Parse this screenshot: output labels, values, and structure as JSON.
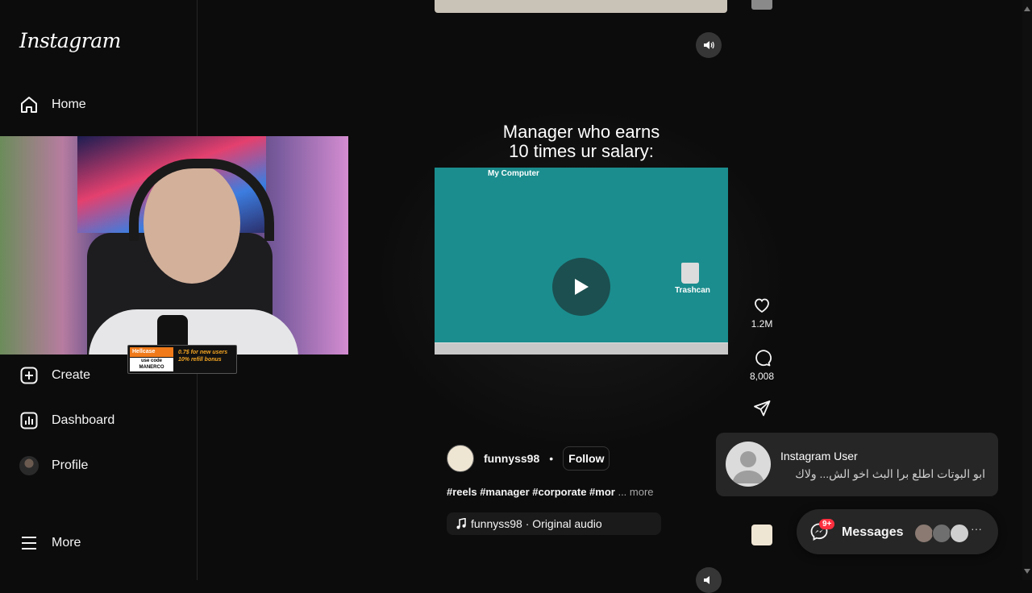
{
  "app": {
    "logo": "Instagram"
  },
  "sidebar": {
    "items": [
      {
        "label": "Home",
        "icon": "home-icon"
      },
      {
        "label": "Create",
        "icon": "create-icon"
      },
      {
        "label": "Dashboard",
        "icon": "dashboard-icon"
      },
      {
        "label": "Profile",
        "icon": "profile-avatar"
      },
      {
        "label": "More",
        "icon": "menu-icon"
      }
    ]
  },
  "overlay": {
    "promo_brand": "Hellcase",
    "promo_code_label": "use code",
    "promo_code": "MANERCO",
    "promo_offer_line1": "0.7$ for new users",
    "promo_offer_line2": "10% refill bonus"
  },
  "reel": {
    "caption_line1": "Manager who earns",
    "caption_line2": "10 times ur salary:",
    "desktop_label": "My Computer",
    "trash_label": "Trashcan",
    "likes": "1.2M",
    "comments": "8,008",
    "username": "funnyss98",
    "follow_label": "Follow",
    "separator": "•",
    "hashtags": "#reels #manager #corporate #mor",
    "more_label": "... more",
    "audio": "funnyss98 · Original audio"
  },
  "notification": {
    "title": "Instagram User",
    "message": "ابو البوتات اطلع برا البث اخو الش... ولاك"
  },
  "messages": {
    "label": "Messages",
    "badge": "9+"
  },
  "colors": {
    "background": "#0c0c0c",
    "video_teal": "#1b8d8e",
    "badge_red": "#ff3040"
  }
}
